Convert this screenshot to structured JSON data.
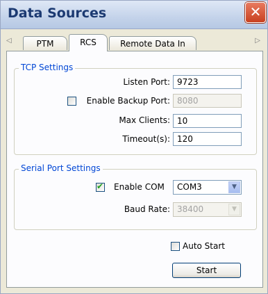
{
  "window": {
    "title": "Data Sources",
    "close_glyph": "✕"
  },
  "tabs": {
    "items": [
      {
        "label": "PTM"
      },
      {
        "label": "RCS",
        "active": true
      },
      {
        "label": "Remote Data In"
      }
    ],
    "scroll_left_glyph": "◁",
    "scroll_right_glyph": "▷"
  },
  "tcp": {
    "title": "TCP Settings",
    "listen_port": {
      "label": "Listen Port:",
      "value": "9723"
    },
    "backup_port": {
      "label": "Enable Backup Port:",
      "value": "8080",
      "checked": false
    },
    "max_clients": {
      "label": "Max Clients:",
      "value": "10"
    },
    "timeout": {
      "label": "Timeout(s):",
      "value": "120"
    }
  },
  "serial": {
    "title": "Serial Port Settings",
    "enable_com": {
      "label": "Enable COM",
      "value": "COM3",
      "checked": true
    },
    "baud_rate": {
      "label": "Baud Rate:",
      "value": "38400"
    }
  },
  "auto_start": {
    "label": "Auto Start",
    "checked": false
  },
  "start_button": {
    "label": "Start"
  },
  "colors": {
    "group_title": "#0046d5",
    "check_mark": "#21a121",
    "close_button": "#c8401f"
  }
}
